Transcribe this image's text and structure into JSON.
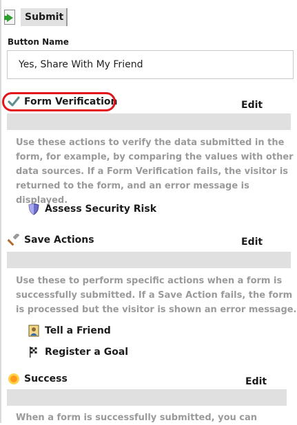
{
  "header": {
    "title": "Submit",
    "icon": "submit-arrow-icon"
  },
  "button_name": {
    "label": "Button Name",
    "value": "Yes, Share With My Friend"
  },
  "sections": [
    {
      "title": "Form Verification",
      "icon": "checkmark-icon",
      "edit_label": "Edit",
      "description": "Use these actions to verify the data submitted in the form, for example, by comparing the values with other data sources. If a Form Verification fails, the visitor is returned to the form, and an error message is displayed.",
      "actions": [
        {
          "label": "Assess Security Risk",
          "icon": "shield-icon"
        }
      ]
    },
    {
      "title": "Save Actions",
      "icon": "hammer-icon",
      "edit_label": "Edit",
      "description": "Use these to perform specific actions when a form is successfully submitted. If a Save Action fails, the form is processed but the visitor is shown an error message.",
      "actions": [
        {
          "label": "Tell a Friend",
          "icon": "person-card-icon"
        },
        {
          "label": "Register a Goal",
          "icon": "checkered-flag-icon"
        }
      ]
    },
    {
      "title": "Success",
      "icon": "sun-icon",
      "edit_label": "Edit",
      "description": "When a form is successfully submitted, you can"
    }
  ],
  "colors": {
    "highlight": "#e3151a",
    "description_text": "#9a9a9a",
    "drop_zone": "#e0e0e0"
  }
}
